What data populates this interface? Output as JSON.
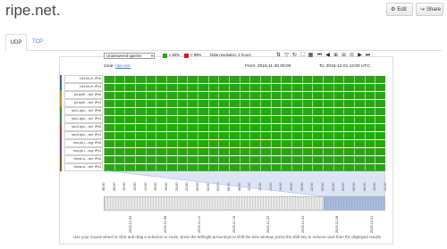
{
  "header": {
    "title": "ripe.net.",
    "edit_label": "Edit",
    "share_label": "Share"
  },
  "tabs": [
    {
      "label": "UDP",
      "active": true
    },
    {
      "label": "TCP",
      "active": false
    }
  ],
  "toolbar": {
    "query_select": "Unanswered queries",
    "legend": [
      {
        "color": "#2ca316",
        "label": "≤ 66%"
      },
      {
        "color": "#d9181c",
        "label": "> 99%"
      }
    ],
    "data_resolution": "Data resolution: 2 hours",
    "icons": [
      "sort-icon",
      "filter-icon",
      "refresh-icon",
      "zoom-select-icon",
      "calendar-icon",
      "first-icon",
      "prev-icon",
      "zoom-in-icon",
      "zoom-out-icon",
      "zoom-reset-icon",
      "next-icon",
      "last-icon"
    ]
  },
  "zone": {
    "prefix": "zone:",
    "link": "ripe.net.",
    "from": "From: 2015-11-30 06:00",
    "to": "To: 2015-12-01 12:00 UTC"
  },
  "rows": [
    {
      "label": "ns3.nic.fr. IPv6",
      "color": "#2e6da4"
    },
    {
      "label": "ns3.nic.fr. IPv4",
      "color": "#2e6da4"
    },
    {
      "label": "pri.auth....net. IPv6",
      "color": "#d58512"
    },
    {
      "label": "pri.auth....net. IPv4",
      "color": "#d58512"
    },
    {
      "label": "sec1.apn....net. IPv6",
      "color": "#3c8d3c"
    },
    {
      "label": "sec1.apn....net. IPv4",
      "color": "#3c8d3c"
    },
    {
      "label": "sec3.apn....net. IPv6",
      "color": "#a94442"
    },
    {
      "label": "sec3.apn....net. IPv4",
      "color": "#a94442"
    },
    {
      "label": "sns-pb.i....org. IPv6",
      "color": "#6f4a9a"
    },
    {
      "label": "sns-pb.i....org. IPv4",
      "color": "#6f4a9a"
    },
    {
      "label": "tinnie.a....net. IPv6",
      "color": "#8a5a2b"
    },
    {
      "label": "tinnie.a....net. IPv4",
      "color": "#8a5a2b"
    }
  ],
  "time_ticks": [
    "06:00",
    "08:00",
    "10:00",
    "12:00",
    "14:00",
    "16:00",
    "18:00",
    "20:00",
    "22:00",
    "00:00",
    "02:00",
    "04:00",
    "06:00",
    "08:00",
    "10:00",
    "12:00",
    "14:00",
    "16:00",
    "18:00",
    "20:00",
    "22:00",
    "00:00",
    "02:00",
    "04:00",
    "06:00",
    "08:00",
    "10:00",
    "12:00"
  ],
  "overview_ticks": [
    "2015-11-04",
    "2015-11-08",
    "2015-11-12",
    "2015-11-16",
    "2015-11-20",
    "2015-11-24",
    "2015-11-28",
    "2015-12-01"
  ],
  "help_text": "Use your mouse wheel or click and drag a selection to zoom, press the left/right arrow keys to shift the time window, press the shift key to remove rows from the displayed results"
}
